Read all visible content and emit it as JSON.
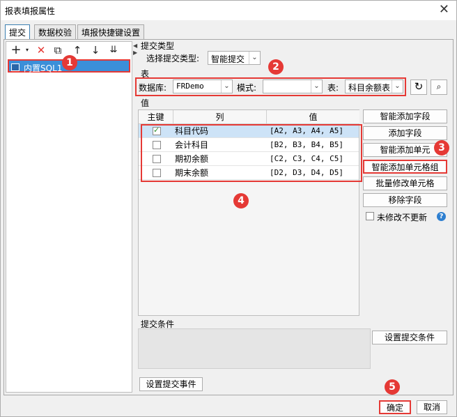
{
  "window": {
    "title": "报表填报属性",
    "close": "✕"
  },
  "tabs": [
    "提交",
    "数据校验",
    "填报快捷键设置"
  ],
  "datasource": {
    "name": "内置SQL1"
  },
  "submit_type": {
    "section": "提交类型",
    "label": "选择提交类型:",
    "value": "智能提交"
  },
  "table_section": {
    "section": "表",
    "db_label": "数据库:",
    "db_value": "FRDemo",
    "mode_label": "模式:",
    "mode_value": "",
    "table_label": "表:",
    "table_value": "科目余额表"
  },
  "value_section": {
    "section": "值",
    "headers": {
      "key": "主键",
      "column": "列",
      "value": "值"
    },
    "rows": [
      {
        "key": true,
        "column": "科目代码",
        "value": "[A2, A3, A4, A5]"
      },
      {
        "key": false,
        "column": "会计科目",
        "value": "[B2, B3, B4, B5]"
      },
      {
        "key": false,
        "column": "期初余额",
        "value": "[C2, C3, C4, C5]"
      },
      {
        "key": false,
        "column": "期末余额",
        "value": "[D2, D3, D4, D5]"
      }
    ]
  },
  "side_buttons": {
    "smart_add_field": "智能添加字段",
    "add_field": "添加字段",
    "smart_add_cell": "智能添加单元",
    "smart_add_cell_group": "智能添加单元格组",
    "batch_modify": "批量修改单元格",
    "remove_field": "移除字段",
    "no_update_label": "未修改不更新",
    "help": "?"
  },
  "condition": {
    "section": "提交条件",
    "set_button": "设置提交条件"
  },
  "event_button": "设置提交事件",
  "footer": {
    "ok": "确定",
    "cancel": "取消"
  },
  "badges": [
    "1",
    "2",
    "3",
    "4",
    "5"
  ],
  "accent_color": "#e53935"
}
